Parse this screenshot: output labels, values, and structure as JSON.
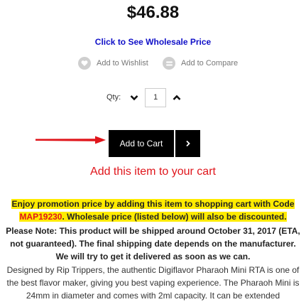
{
  "product": {
    "price": "$46.88",
    "wholesale_link": "Click to See Wholesale Price"
  },
  "actions": {
    "wishlist_label": "Add to Wishlist",
    "compare_label": "Add to Compare",
    "wishlist_icon": "heart-icon",
    "compare_icon": "compare-icon"
  },
  "quantity": {
    "label": "Qty:",
    "value": "1",
    "decrease_icon": "chevron-down-icon",
    "increase_icon": "chevron-up-icon"
  },
  "cart": {
    "button_label": "Add to Cart",
    "next_icon": "chevron-right-icon",
    "hint": "Add this item to your cart",
    "hint_color": "#e0151b",
    "pointer_icon": "red-arrow-icon"
  },
  "promo": {
    "line1_part1": "Enjoy promotion price by adding this item to shopping cart with Code",
    "code": "MAP19230",
    "line2_rest": ". Wholesale price (listed below) will also be discounted.",
    "highlight_color": "#ffeb00"
  },
  "notice": {
    "text": "Please Note: This product will be shipped around October 31, 2017 (ETA, not guaranteed). The final shipping date depends on the manufacturer. We will try to get it delivered as soon as we can."
  },
  "description": {
    "text": "Designed by Rip Trippers, the authentic Digiflavor Pharaoh Mini RTA is one of the best flavor maker, giving you best vaping experience. The Pharaoh Mini is 24mm in diameter and comes with 2ml capacity. It can be extended"
  }
}
